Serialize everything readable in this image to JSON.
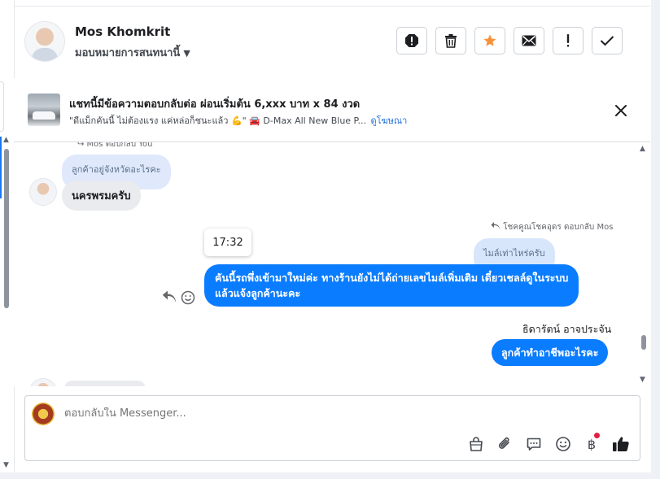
{
  "header": {
    "name": "Mos Khomkrit",
    "assign_label": "มอบหมายการสนทนานี้",
    "caret": "▼"
  },
  "banner": {
    "title": "แชทนี้มีข้อความตอบกลับต่อ ผ่อนเริ่มต้น 6,xxx บาท x 84 งวด",
    "subtitle": "\"ดีแม็กคันนี้ ไม่ต้องแรง แค่หล่อก็ชนะแล้ว 💪\" 🚘 D-Max All New Blue P...",
    "link": "ดูโฆษณา"
  },
  "chat": {
    "reply_context_1": "↪ Mos ตอบกลับ You",
    "quoted_1": "ลูกค้าอยู่จังหวัดอะไรคะ",
    "incoming_1": "นครพรมครับ",
    "reply_context_2": "โชคคูณโชคอุดร ตอบกลับ Mos",
    "quoted_2": "ไมล์เท่าไหร่ครับ",
    "time_tooltip": "17:32",
    "outgoing_1_line1": "คันนี้รถพึ่งเข้ามาใหม่ค่ะ ทางร้านยังไม่ได้ถ่ายเลขไมล์เพิ่มเติม เดี๋ยวเชลล์ดูในระบบ",
    "outgoing_1_line2": "แล้วแจ้งลูกค้านะคะ",
    "sender_name": "ธิดารัตน์ อาจประจัน",
    "outgoing_2": "ลูกค้าทำอาชีพอะไรคะ"
  },
  "composer": {
    "placeholder": "ตอบกลับใน Messenger...",
    "baht_symbol": "฿"
  },
  "icons": [
    "report-icon",
    "trash-icon",
    "star-icon",
    "mail-icon",
    "exclamation-icon",
    "check-icon",
    "close-icon",
    "reply-icon",
    "emoji-react-icon",
    "bag-icon",
    "attachment-icon",
    "saved-reply-icon",
    "emoji-icon",
    "baht-icon",
    "like-icon"
  ],
  "colors": {
    "accent": "#0a7cff",
    "star": "#f7923b",
    "link": "#216fdb"
  }
}
